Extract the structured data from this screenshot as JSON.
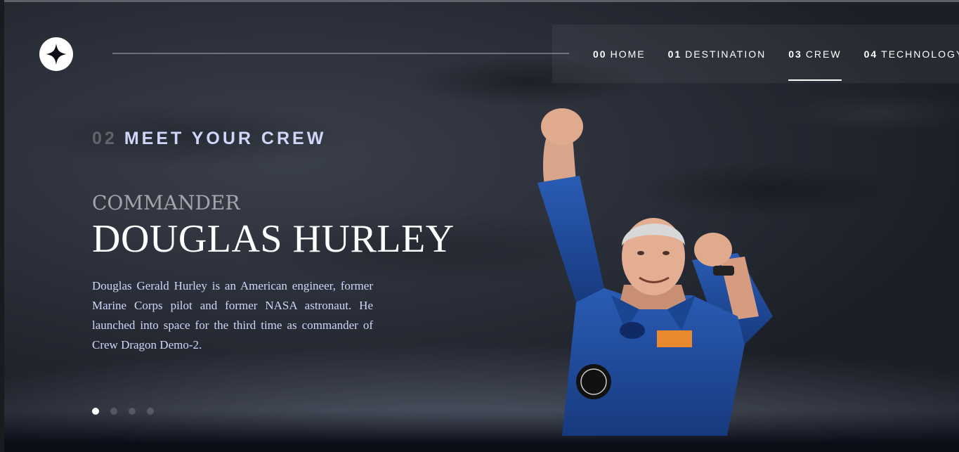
{
  "nav": {
    "items": [
      {
        "num": "00",
        "label": "HOME"
      },
      {
        "num": "01",
        "label": "DESTINATION"
      },
      {
        "num": "03",
        "label": "CREW"
      },
      {
        "num": "04",
        "label": "TECHNOLOGY"
      }
    ],
    "active": "CREW"
  },
  "page": {
    "number": "02",
    "heading": "MEET YOUR CREW"
  },
  "crew": {
    "role": "Commander",
    "name": "Douglas Hurley",
    "bio": "Douglas Gerald Hurley is an American engineer, former Marine Corps pilot and former NASA astronaut. He launched into space for the third time as commander of Crew Dragon Demo-2."
  },
  "slider": {
    "count": 4,
    "active_index": 0
  },
  "colors": {
    "accent": "#d0d6f9",
    "background": "#0b0d17",
    "suit_blue": "#1f4b9a"
  },
  "icons": {
    "logo": "star-icon"
  }
}
